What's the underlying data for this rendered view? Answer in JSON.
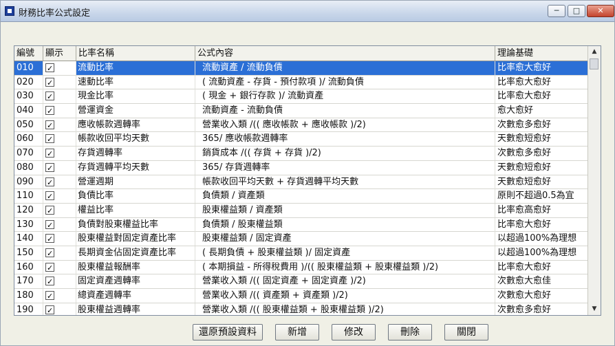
{
  "window": {
    "title": "財務比率公式設定",
    "controls": {
      "minimize": "─",
      "maximize": "□",
      "close": "✕"
    }
  },
  "table": {
    "headers": {
      "no": "編號",
      "show": "顯示",
      "name": "比率名稱",
      "formula": "公式內容",
      "basis": "理論基礎"
    },
    "rows": [
      {
        "no": "010",
        "show": true,
        "name": "流動比率",
        "formula": "流動資產 / 流動負債",
        "basis": "比率愈大愈好",
        "selected": true
      },
      {
        "no": "020",
        "show": true,
        "name": "速動比率",
        "formula": "( 流動資產 - 存貨 - 預付款項 )/ 流動負債",
        "basis": "比率愈大愈好"
      },
      {
        "no": "030",
        "show": true,
        "name": "現金比率",
        "formula": "( 現金 + 銀行存款 )/ 流動資產",
        "basis": "比率愈大愈好"
      },
      {
        "no": "040",
        "show": true,
        "name": "營運資金",
        "formula": "流動資產 - 流動負債",
        "basis": "愈大愈好"
      },
      {
        "no": "050",
        "show": true,
        "name": "應收帳款週轉率",
        "formula": "營業收入類 /(( 應收帳款 + 應收帳款 )/2)",
        "basis": "次數愈多愈好"
      },
      {
        "no": "060",
        "show": true,
        "name": "帳款收回平均天數",
        "formula": "365/ 應收帳款週轉率",
        "basis": "天數愈短愈好"
      },
      {
        "no": "070",
        "show": true,
        "name": "存貨週轉率",
        "formula": "銷貨成本 /(( 存貨 + 存貨 )/2)",
        "basis": "次數愈多愈好"
      },
      {
        "no": "080",
        "show": true,
        "name": "存貨週轉平均天數",
        "formula": "365/ 存貨週轉率",
        "basis": "天數愈短愈好"
      },
      {
        "no": "090",
        "show": true,
        "name": "營運週期",
        "formula": "帳款收回平均天數 + 存貨週轉平均天數",
        "basis": "天數愈短愈好"
      },
      {
        "no": "110",
        "show": true,
        "name": "負債比率",
        "formula": "負債類 / 資產類",
        "basis": "原則不超過0.5為宜"
      },
      {
        "no": "120",
        "show": true,
        "name": "權益比率",
        "formula": "股東權益類 / 資產類",
        "basis": "比率愈高愈好"
      },
      {
        "no": "130",
        "show": true,
        "name": "負債對股東權益比率",
        "formula": "負債類 / 股東權益類",
        "basis": "比率愈大愈好"
      },
      {
        "no": "140",
        "show": true,
        "name": "股東權益對固定資產比率",
        "formula": "股東權益類 / 固定資產",
        "basis": "以超過100%為理想"
      },
      {
        "no": "150",
        "show": true,
        "name": "長期資金佔固定資產比率",
        "formula": "( 長期負債 + 股東權益類 )/ 固定資產",
        "basis": "以超過100%為理想"
      },
      {
        "no": "160",
        "show": true,
        "name": "股東權益報酬率",
        "formula": "( 本期損益 - 所得稅費用 )/(( 股東權益類 + 股東權益類 )/2)",
        "basis": "比率愈大愈好"
      },
      {
        "no": "170",
        "show": true,
        "name": "固定資產週轉率",
        "formula": "營業收入類 /(( 固定資產 + 固定資產 )/2)",
        "basis": "次數愈大愈佳"
      },
      {
        "no": "180",
        "show": true,
        "name": "總資產週轉率",
        "formula": "營業收入類 /(( 資產類 + 資產類 )/2)",
        "basis": "次數愈大愈好"
      },
      {
        "no": "190",
        "show": true,
        "name": "股東權益週轉率",
        "formula": "營業收入類 /(( 股東權益類 + 股東權益類 )/2)",
        "basis": "次數愈多愈好"
      }
    ]
  },
  "buttons": {
    "restore": "還原預設資料",
    "add": "新增",
    "edit": "修改",
    "delete": "刪除",
    "close": "關閉"
  },
  "scrollbar": {
    "up": "▲",
    "down": "▼"
  }
}
